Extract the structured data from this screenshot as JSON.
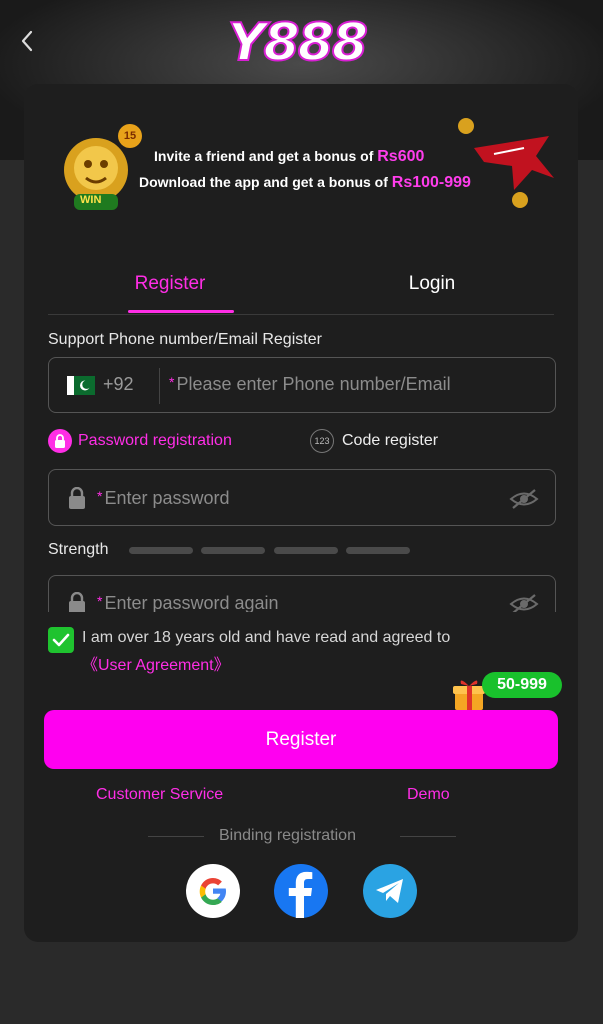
{
  "header": {
    "logo_text": "Y888"
  },
  "banner": {
    "line1_text": "Invite a friend and get a bonus of",
    "line1_amount": "Rs600",
    "line2_text": "Download the app and get a bonus of",
    "line2_amount": "Rs100-999",
    "badge": "15",
    "win_label": "WIN"
  },
  "tabs": [
    {
      "label": "Register",
      "active": true
    },
    {
      "label": "Login",
      "active": false
    }
  ],
  "form": {
    "support_label": "Support Phone number/Email Register",
    "country_code": "+92",
    "phone_placeholder": "Please enter Phone number/Email",
    "password_mode_label": "Password registration",
    "code_mode_badge": "123",
    "code_mode_label": "Code register",
    "password_placeholder": "Enter password",
    "strength_label": "Strength",
    "confirm_placeholder": "Enter password again",
    "agreement_text": "I am over 18 years old and have read and agreed to",
    "agreement_link": "《User Agreement》",
    "agreement_checked": true
  },
  "gift_badge": "50-999",
  "register_button": "Register",
  "links": {
    "customer_service": "Customer Service",
    "demo": "Demo"
  },
  "binding_label": "Binding registration",
  "colors": {
    "accent": "#ff00f0",
    "background": "#1e1e1e",
    "check": "#1fc32f"
  }
}
